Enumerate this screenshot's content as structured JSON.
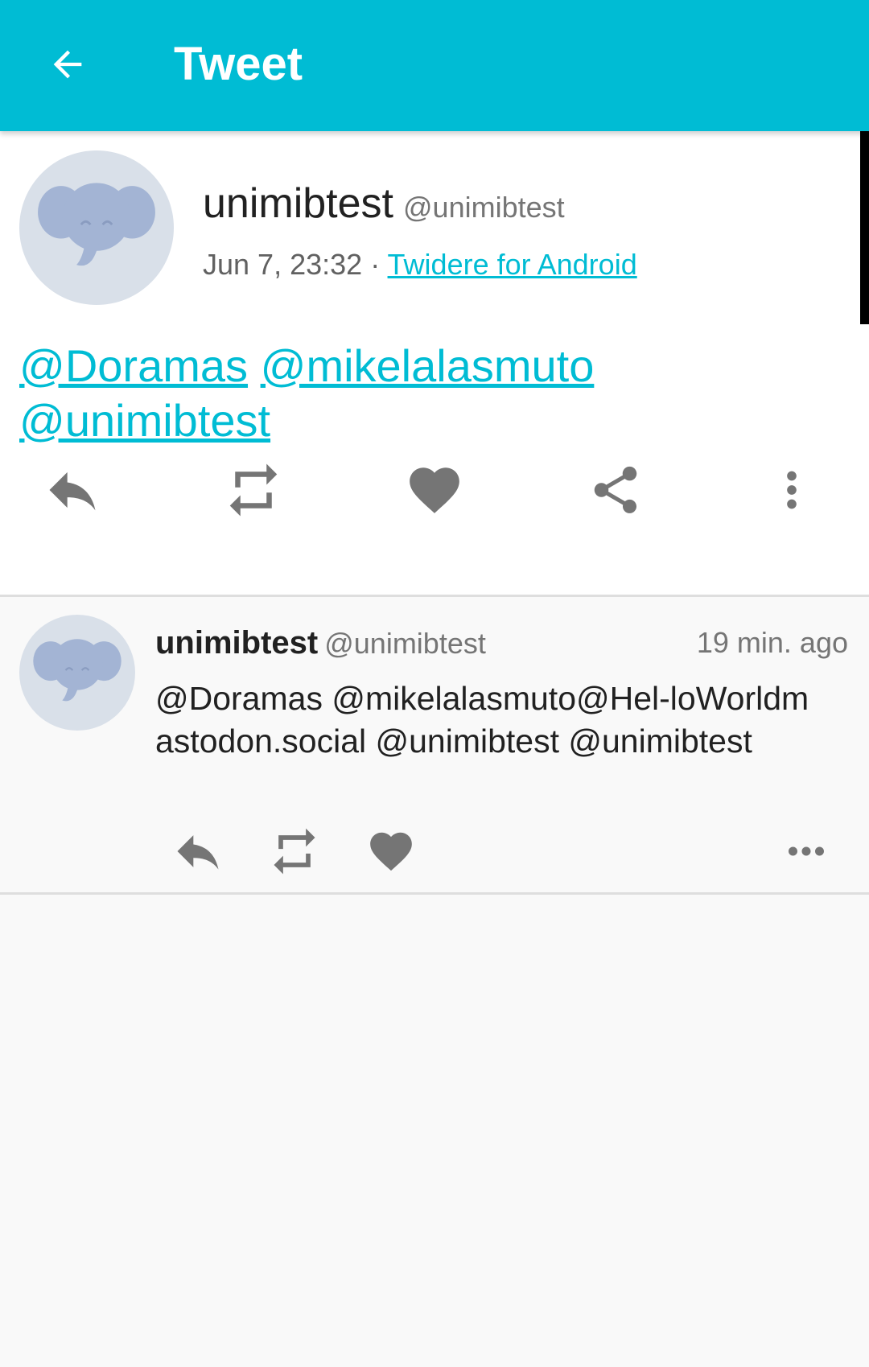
{
  "toolbar": {
    "title": "Tweet",
    "back_icon": "arrow-left-icon",
    "background": "#00bcd4"
  },
  "status": {
    "name": "unimibtest",
    "handle": "@unimibtest",
    "time": "Jun 7, 23:32",
    "separator": "·",
    "source": "Twidere for Android",
    "mentions": [
      "@Doramas",
      "@mikelalasmuto",
      "@unimibtest"
    ],
    "actions": [
      "reply-icon",
      "retweet-icon",
      "favorite-icon",
      "share-icon",
      "more-vertical-icon"
    ]
  },
  "reply": {
    "name": "unimibtest",
    "handle": "@unimibtest",
    "time": "19 min. ago",
    "text": "@Doramas @mikelalasmuto@Hel-loWorldmastodon.social @unimibtest @unimibtest",
    "actions": [
      "reply-icon",
      "retweet-icon",
      "favorite-icon",
      "more-horizontal-icon"
    ]
  },
  "colors": {
    "accent": "#00bcd4",
    "icon": "#757575",
    "avatar_bg": "#d9e0e9",
    "avatar_elephant": "#a3b4d4"
  }
}
